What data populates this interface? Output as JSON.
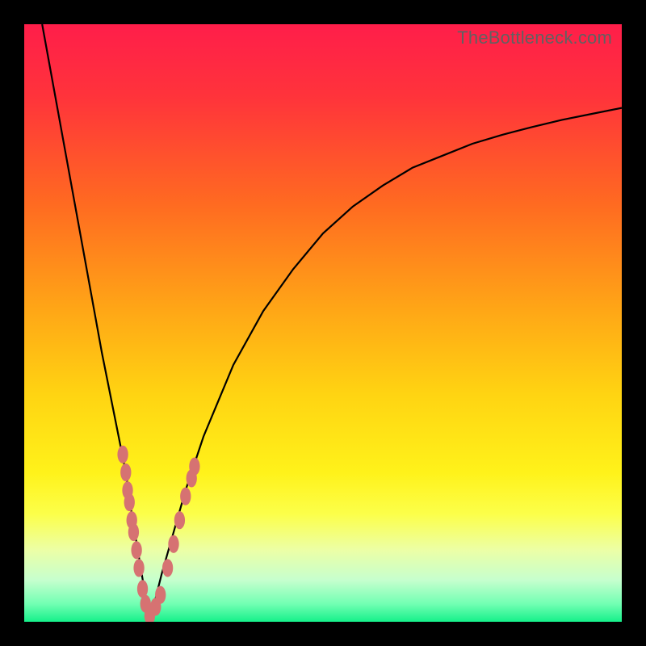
{
  "watermark": {
    "text": "TheBottleneck.com"
  },
  "colors": {
    "frame_border": "#000000",
    "curve": "#000000",
    "markers": "#d67272",
    "gradient_stops": [
      {
        "offset": 0.0,
        "color": "#ff1e4a"
      },
      {
        "offset": 0.12,
        "color": "#ff333b"
      },
      {
        "offset": 0.3,
        "color": "#ff6a21"
      },
      {
        "offset": 0.48,
        "color": "#ffa716"
      },
      {
        "offset": 0.62,
        "color": "#ffd412"
      },
      {
        "offset": 0.75,
        "color": "#fff21a"
      },
      {
        "offset": 0.82,
        "color": "#fcff4a"
      },
      {
        "offset": 0.88,
        "color": "#ecffa6"
      },
      {
        "offset": 0.93,
        "color": "#c6ffce"
      },
      {
        "offset": 0.97,
        "color": "#72ffb3"
      },
      {
        "offset": 1.0,
        "color": "#16f08a"
      }
    ]
  },
  "chart_data": {
    "type": "line",
    "title": "",
    "xlabel": "",
    "ylabel": "",
    "xlim": [
      0,
      100
    ],
    "ylim": [
      0,
      100
    ],
    "notch_x": 21,
    "series": [
      {
        "name": "left-branch",
        "x": [
          3,
          5,
          7,
          9,
          11,
          13,
          15,
          17,
          18,
          19,
          20,
          21
        ],
        "values": [
          100,
          89,
          78,
          67,
          56,
          45,
          35,
          25,
          18,
          12,
          6,
          0
        ]
      },
      {
        "name": "right-branch",
        "x": [
          21,
          23,
          25,
          27,
          30,
          35,
          40,
          45,
          50,
          55,
          60,
          65,
          70,
          75,
          80,
          85,
          90,
          95,
          100
        ],
        "values": [
          0,
          8,
          15,
          22,
          31,
          43,
          52,
          59,
          65,
          69.5,
          73,
          76,
          78,
          80,
          81.5,
          82.8,
          84,
          85,
          86
        ]
      }
    ],
    "markers": [
      {
        "series": "left-branch",
        "x": 16.5,
        "y": 28
      },
      {
        "series": "left-branch",
        "x": 17.0,
        "y": 25
      },
      {
        "series": "left-branch",
        "x": 17.3,
        "y": 22
      },
      {
        "series": "left-branch",
        "x": 17.6,
        "y": 20
      },
      {
        "series": "left-branch",
        "x": 18.0,
        "y": 17
      },
      {
        "series": "left-branch",
        "x": 18.3,
        "y": 15
      },
      {
        "series": "left-branch",
        "x": 18.8,
        "y": 12
      },
      {
        "series": "left-branch",
        "x": 19.2,
        "y": 9
      },
      {
        "series": "left-branch",
        "x": 19.8,
        "y": 5.5
      },
      {
        "series": "left-branch",
        "x": 20.3,
        "y": 3
      },
      {
        "series": "left-branch",
        "x": 21.0,
        "y": 1
      },
      {
        "series": "right-branch",
        "x": 22.0,
        "y": 2.5
      },
      {
        "series": "right-branch",
        "x": 22.8,
        "y": 4.5
      },
      {
        "series": "right-branch",
        "x": 24.0,
        "y": 9
      },
      {
        "series": "right-branch",
        "x": 25.0,
        "y": 13
      },
      {
        "series": "right-branch",
        "x": 26.0,
        "y": 17
      },
      {
        "series": "right-branch",
        "x": 27.0,
        "y": 21
      },
      {
        "series": "right-branch",
        "x": 28.0,
        "y": 24
      },
      {
        "series": "right-branch",
        "x": 28.5,
        "y": 26
      }
    ]
  }
}
